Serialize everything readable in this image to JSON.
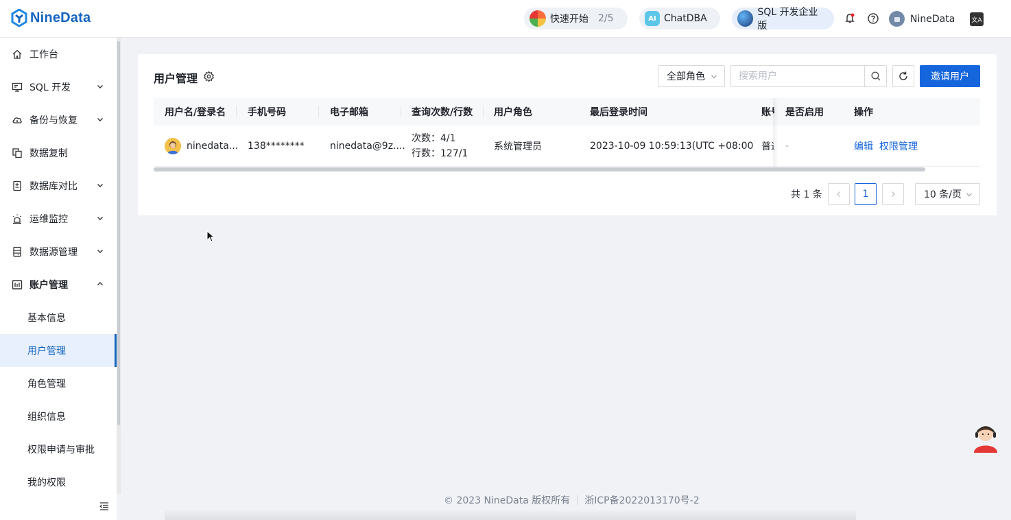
{
  "header": {
    "logo_text": "NineData",
    "quick_start": {
      "label": "快速开始",
      "progress": "2/5"
    },
    "chatdba": {
      "label": "ChatDBA",
      "icon_text": "AI"
    },
    "sql_plan": {
      "label": "SQL 开发企业版"
    },
    "user": {
      "name": "NineData"
    },
    "icons": [
      "bell-icon",
      "help-icon",
      "language-icon"
    ]
  },
  "sidebar": {
    "items": [
      {
        "label": "工作台",
        "icon": "home-icon",
        "expandable": false
      },
      {
        "label": "SQL 开发",
        "icon": "monitor-icon",
        "expandable": true
      },
      {
        "label": "备份与恢复",
        "icon": "cloud-icon",
        "expandable": true
      },
      {
        "label": "数据复制",
        "icon": "copy-icon",
        "expandable": false
      },
      {
        "label": "数据库对比",
        "icon": "compare-icon",
        "expandable": true
      },
      {
        "label": "运维监控",
        "icon": "alarm-icon",
        "expandable": true
      },
      {
        "label": "数据源管理",
        "icon": "database-icon",
        "expandable": true
      },
      {
        "label": "账户管理",
        "icon": "account-icon",
        "expandable": true,
        "expanded": true
      }
    ],
    "sub_items": [
      "基本信息",
      "用户管理",
      "角色管理",
      "组织信息",
      "权限申请与审批",
      "我的权限"
    ],
    "active_sub": "用户管理"
  },
  "main": {
    "title": "用户管理",
    "role_filter": "全部角色",
    "search_placeholder": "搜索用户",
    "invite_label": "邀请用户",
    "columns": [
      "用户名/登录名",
      "手机号码",
      "电子邮箱",
      "查询次数/行数",
      "用户角色",
      "最后登录时间",
      "账号",
      "是否启用",
      "操作"
    ],
    "rows": [
      {
        "username": "ninedata...",
        "phone": "138********",
        "email": "ninedata@9z....",
        "query_count_label": "次数：",
        "query_count": "4/1",
        "query_rows_label": "行数：",
        "query_rows": "127/1",
        "role": "系统管理员",
        "last_login": "2023-10-09 10:59:13(UTC +08:00)",
        "account_type": "普通",
        "enabled": "-",
        "actions": [
          "编辑",
          "权限管理"
        ]
      }
    ],
    "pagination": {
      "total": "共 1 条",
      "current_page": "1",
      "page_size": "10 条/页"
    }
  },
  "footer": {
    "copyright": "© 2023 NineData 版权所有",
    "icp": "浙ICP备2022013170号-2"
  },
  "colors": {
    "brand": "#1565dc",
    "active_bg": "#e8f0fd",
    "page_bg": "#f0f2f5"
  }
}
